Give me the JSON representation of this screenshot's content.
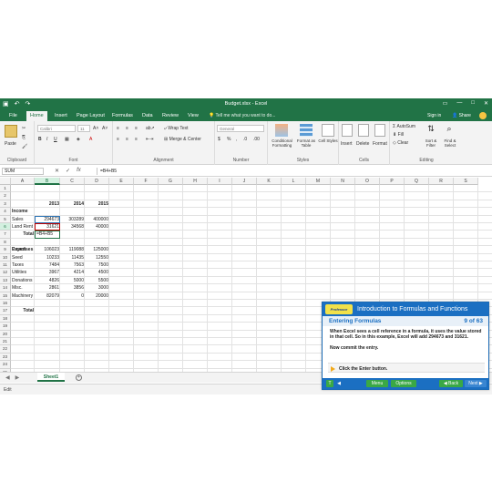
{
  "window": {
    "title": "Budget.xlsx - Excel",
    "controls": [
      "—",
      "□",
      "✕"
    ]
  },
  "tabs": {
    "items": [
      "File",
      "Home",
      "Insert",
      "Page Layout",
      "Formulas",
      "Data",
      "Review",
      "View"
    ],
    "tell_me": "Tell me what you want to do...",
    "sign_in": "Sign in",
    "share": "Share"
  },
  "ribbon": {
    "clipboard": {
      "label": "Clipboard",
      "paste": "Paste"
    },
    "font": {
      "label": "Font",
      "name": "Calibri",
      "size": "11",
      "bold": "B",
      "italic": "I",
      "underline": "U"
    },
    "alignment": {
      "label": "Alignment",
      "wrap": "Wrap Text",
      "merge": "Merge & Center"
    },
    "number": {
      "label": "Number",
      "format": "General",
      "currency": "$",
      "percent": "%"
    },
    "styles": {
      "label": "Styles",
      "conditional": "Conditional Formatting",
      "format_as": "Format as Table",
      "cell_styles": "Cell Styles"
    },
    "cells": {
      "label": "Cells",
      "insert": "Insert",
      "delete": "Delete",
      "format": "Format"
    },
    "editing": {
      "label": "Editing",
      "autosum": "AutoSum",
      "fill": "Fill",
      "clear": "Clear",
      "sort": "Sort & Filter",
      "find": "Find & Select"
    }
  },
  "formula_bar": {
    "name_box": "SUM",
    "cancel": "✕",
    "enter": "✓",
    "fx": "fx",
    "formula": "=B4+B5"
  },
  "columns": [
    "A",
    "B",
    "C",
    "D",
    "E",
    "F",
    "G",
    "H",
    "I",
    "J",
    "K",
    "L",
    "M",
    "N",
    "O",
    "P",
    "Q",
    "R",
    "S"
  ],
  "rows": [
    "1",
    "2",
    "3",
    "4",
    "5",
    "6",
    "7",
    "8",
    "9",
    "10",
    "11",
    "12",
    "13",
    "14",
    "15",
    "16",
    "17",
    "18",
    "19",
    "20",
    "21",
    "22",
    "23",
    "24",
    "25"
  ],
  "cells": {
    "years": [
      "2013",
      "2014",
      "2015"
    ],
    "income": "Income",
    "sales": {
      "label": "Sales",
      "values": [
        "294673",
        "303289",
        "400000"
      ]
    },
    "land_rent": {
      "label": "Land Rent",
      "values": [
        "31621",
        "34568",
        "40000"
      ]
    },
    "total_income": "Total",
    "active_formula": "=B4+B5",
    "expenses": "Expenses",
    "expense_rows": [
      {
        "label": "Payroll",
        "values": [
          "106023",
          "119088",
          "125000"
        ]
      },
      {
        "label": "Seed",
        "values": [
          "10233",
          "11435",
          "12550"
        ]
      },
      {
        "label": "Taxes",
        "values": [
          "7484",
          "7563",
          "7500"
        ]
      },
      {
        "label": "Utilities",
        "values": [
          "3967",
          "4214",
          "4500"
        ]
      },
      {
        "label": "Donations",
        "values": [
          "4826",
          "5000",
          "5500"
        ]
      },
      {
        "label": "Misc.",
        "values": [
          "2861",
          "3856",
          "3000"
        ]
      },
      {
        "label": "Machinery",
        "values": [
          "82079",
          "0",
          "20000"
        ]
      }
    ],
    "total_expenses": "Total"
  },
  "sheet": {
    "tab": "Sheet1",
    "add": "+"
  },
  "status": {
    "mode": "Edit"
  },
  "tutorial": {
    "logo": "Professor Teaches",
    "title": "Introduction to Formulas and Functions",
    "section": "Entering Formulas",
    "counter": "9 of 63",
    "body1": "When Excel sees a cell reference in a formula, it uses the value stored in that cell. So in this example, Excel will add 294673 and 31621.",
    "body2": "Now commit the entry.",
    "instruction": "Click the Enter button.",
    "buttons": {
      "info": "T",
      "volume": "◀",
      "menu": "Menu",
      "options": "Options",
      "back": "◀ Back",
      "next": "Next ▶"
    }
  },
  "colors": {
    "excel_green": "#217346",
    "tutorial_blue": "#1b6fc2",
    "ref_blue": "#2e75b6",
    "ref_red": "#c00000"
  }
}
